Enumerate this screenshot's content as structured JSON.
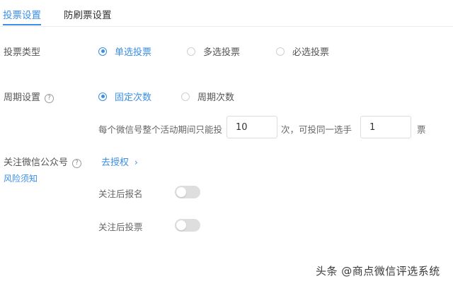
{
  "tabs": [
    {
      "label": "投票设置",
      "active": true
    },
    {
      "label": "防刷票设置",
      "active": false
    }
  ],
  "vote_type": {
    "label": "投票类型",
    "options": [
      {
        "label": "单选投票",
        "checked": true
      },
      {
        "label": "多选投票",
        "checked": false
      },
      {
        "label": "必选投票",
        "checked": false
      }
    ]
  },
  "period": {
    "label": "周期设置",
    "help_icon": "question-circle-icon",
    "options": [
      {
        "label": "固定次数",
        "checked": true
      },
      {
        "label": "周期次数",
        "checked": false
      }
    ],
    "limit": {
      "prefix": "每个微信号整个活动期间只能投",
      "count_value": "10",
      "middle": "次，可投同一选手",
      "same_value": "1",
      "suffix": "票"
    }
  },
  "follow": {
    "label": "关注微信公众号",
    "help_icon": "question-circle-icon",
    "risk_link": "风险须知",
    "authorize_link": "去授权",
    "toggles": [
      {
        "label": "关注后报名",
        "on": false
      },
      {
        "label": "关注后投票",
        "on": false
      }
    ]
  },
  "colors": {
    "accent": "#3a8ee6",
    "toggle_off": "#dedede"
  },
  "watermark": "头条 @商点微信评选系统"
}
